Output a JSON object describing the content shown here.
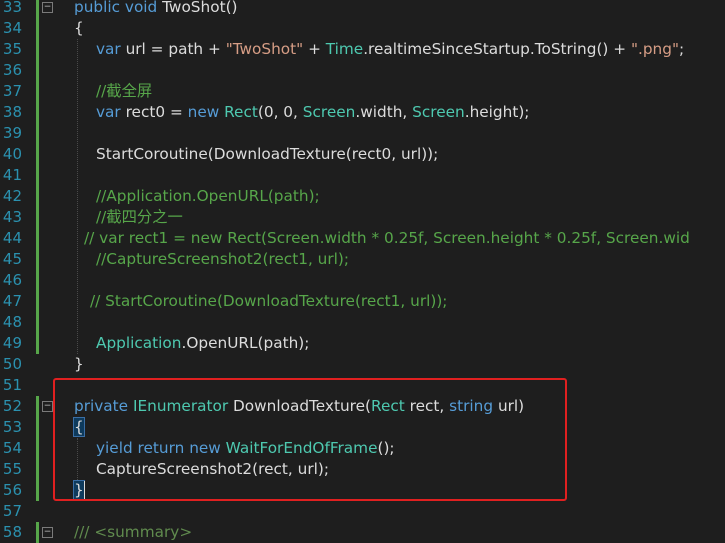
{
  "editor": {
    "line_numbers": [
      "33",
      "34",
      "35",
      "36",
      "37",
      "38",
      "39",
      "40",
      "41",
      "42",
      "43",
      "44",
      "45",
      "46",
      "47",
      "48",
      "49",
      "50",
      "51",
      "52",
      "53",
      "54",
      "55",
      "56",
      "57",
      "58"
    ],
    "lines": {
      "l33": {
        "public": "public ",
        "void": "void ",
        "name": "TwoShot()"
      },
      "l34": {
        "brace": "{"
      },
      "l35": {
        "var": "var ",
        "mid": "url = path + ",
        "s1": "\"TwoShot\"",
        "plus": " + ",
        "time": "Time",
        "rest": ".realtimeSinceStartup.ToString() + ",
        "s2": "\".png\"",
        "end": ";"
      },
      "l37": {
        "comment": "//截全屏"
      },
      "l38": {
        "var": "var ",
        "a": "rect0 = ",
        "new": "new ",
        "rect": "Rect",
        "b": "(0, 0, ",
        "screen1": "Screen",
        ".w": ".width, ",
        "screen2": "Screen",
        "c": ".height);"
      },
      "l40": {
        "text": "StartCoroutine(DownloadTexture(rect0, url));"
      },
      "l42": {
        "comment": "//Application.OpenURL(path);"
      },
      "l43": {
        "comment": "//截四分之一"
      },
      "l44": {
        "comment": "// var rect1 = new Rect(Screen.width * 0.25f, Screen.height * 0.25f, Screen.wid"
      },
      "l45": {
        "comment": "//CaptureScreenshot2(rect1, url);"
      },
      "l47": {
        "comment": "// StartCoroutine(DownloadTexture(rect1, url));"
      },
      "l49": {
        "app": "Application",
        "rest": ".OpenURL(path);"
      },
      "l50": {
        "brace": "}"
      },
      "l52": {
        "private": "private ",
        "ienum": "IEnumerator",
        "a": " DownloadTexture(",
        "rect": "Rect",
        "b": " rect, ",
        "string": "string",
        "c": " url)"
      },
      "l53": {
        "brace": "{"
      },
      "l54": {
        "yield": "yield ",
        "ret": "return ",
        "new": "new ",
        "wait": "WaitForEndOfFrame",
        "end": "();"
      },
      "l55": {
        "text": "CaptureScreenshot2(rect, url);"
      },
      "l56": {
        "brace": "}"
      },
      "l58": {
        "doc": "/// <summary>"
      }
    }
  },
  "colors": {
    "background": "#1e1e1e",
    "line_number": "#2b91af",
    "keyword": "#569cd6",
    "type": "#4ec9b0",
    "string": "#d69d85",
    "comment": "#57a64a",
    "text": "#dcdcdc",
    "highlight_box": "#e02020"
  }
}
